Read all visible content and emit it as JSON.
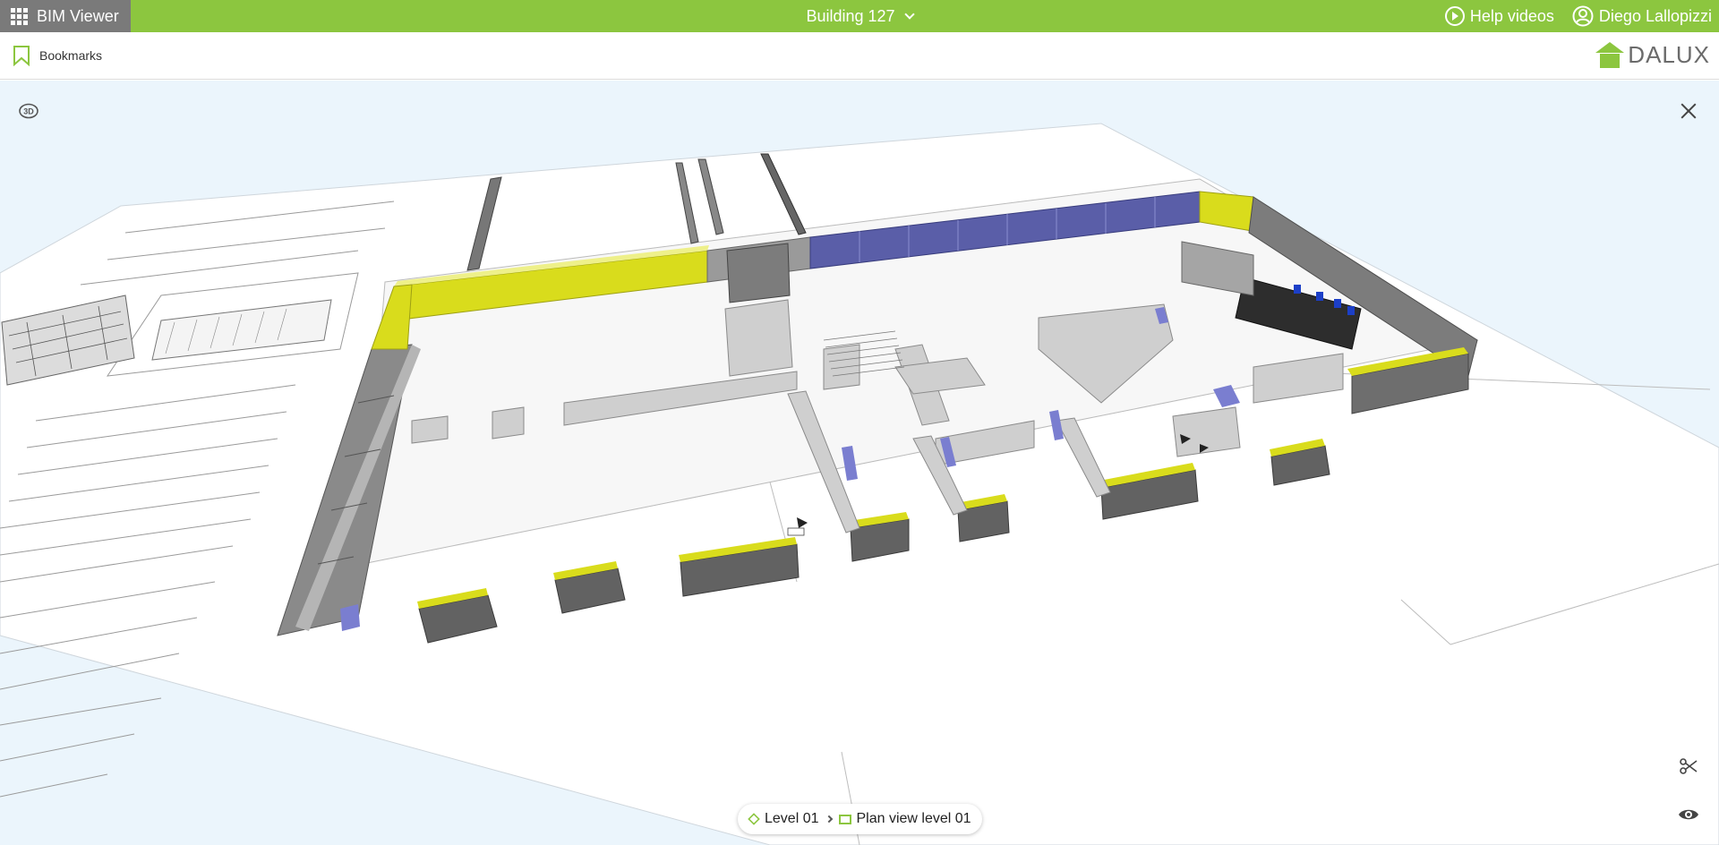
{
  "header": {
    "app_title": "BIM Viewer",
    "project_name": "Building 127",
    "help_label": "Help videos",
    "user_name": "Diego Lallopizzi"
  },
  "subbar": {
    "bookmarks_label": "Bookmarks",
    "logo_text": "DALUX"
  },
  "viewer": {
    "breadcrumb": {
      "level": "Level 01",
      "view": "Plan view level 01"
    },
    "tools": [
      "3d-mode-icon",
      "close-icon",
      "section-scissors-icon",
      "visibility-eye-icon"
    ]
  },
  "colors": {
    "brand_green": "#8cc63f",
    "app_button_gray": "#7a7a7a",
    "viewer_background": "#ebf5fc",
    "wall_yellow": "#d9dc1c",
    "wall_blue": "#5a5ea8",
    "wall_gray": "#6e6e6e"
  }
}
